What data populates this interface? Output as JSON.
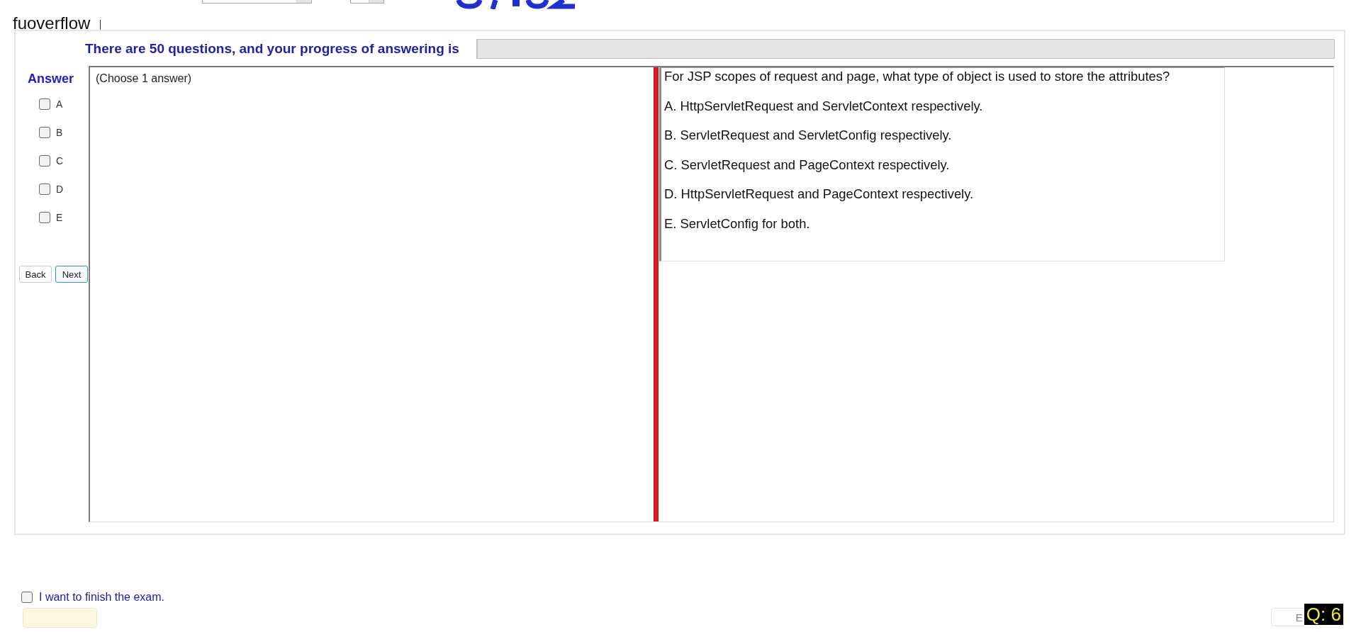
{
  "caption": "fuoverflow",
  "progress": {
    "label": "There are 50 questions, and your progress of answering is",
    "level": 0
  },
  "answer_panel": {
    "title": "Answer",
    "options": [
      {
        "label": "A",
        "checked": false
      },
      {
        "label": "B",
        "checked": false
      },
      {
        "label": "C",
        "checked": false
      },
      {
        "label": "D",
        "checked": false
      },
      {
        "label": "E",
        "checked": false
      }
    ],
    "buttons": [
      {
        "label": "Back",
        "focused": false
      },
      {
        "label": "Next",
        "focused": true
      }
    ]
  },
  "instructions": "(Choose 1 answer)",
  "question": {
    "text": "For JSP scopes of request and page, what type of object is used to store the attributes?",
    "options": [
      "A. HttpServletRequest and ServletContext respectively.",
      "B. ServletRequest and ServletConfig respectively.",
      "C. ServletRequest and PageContext respectively.",
      "D. HttpServletRequest and PageContext respectively.",
      "E. ServletConfig for both."
    ]
  },
  "finish": {
    "label": "I want to finish the exam.",
    "checked": false
  },
  "footer_button": {
    "label": "E"
  },
  "question_badge": "Q: 6"
}
